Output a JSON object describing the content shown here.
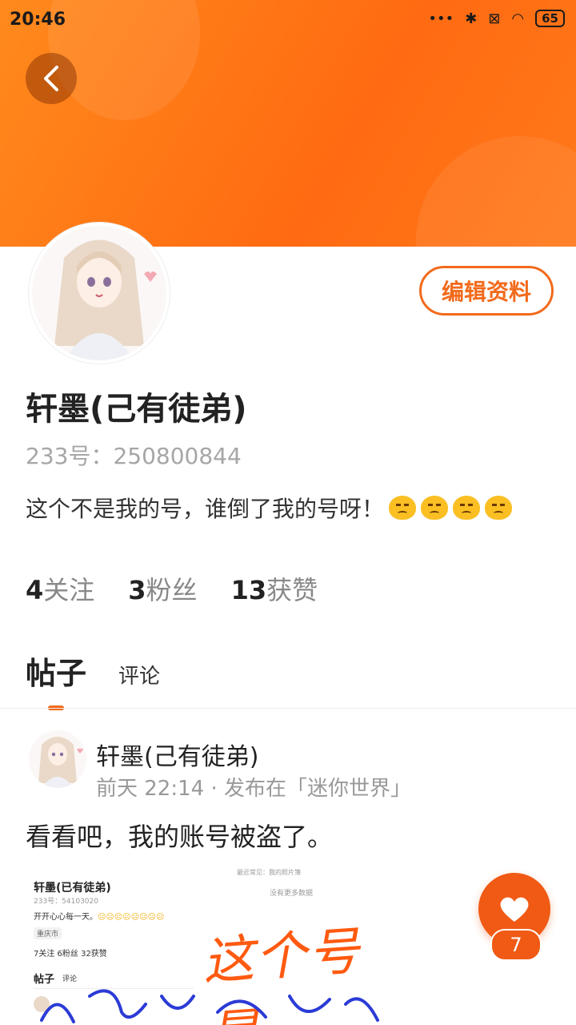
{
  "status_bar": {
    "time": "20:46",
    "battery": "65"
  },
  "profile": {
    "edit_label": "编辑资料",
    "name": "轩墨(己有徒弟)",
    "uid": "233号：250800844",
    "bio": "这个不是我的号，谁倒了我的号呀！",
    "bio_emojis": 4,
    "stats": [
      {
        "num": "4",
        "label": "关注"
      },
      {
        "num": "3",
        "label": "粉丝"
      },
      {
        "num": "13",
        "label": "获赞"
      }
    ]
  },
  "tabs": {
    "posts": "帖子",
    "comments": "评论"
  },
  "post": {
    "author": "轩墨(己有徒弟)",
    "meta": "前天 22:14 · 发布在「迷你世界」",
    "text": "看看吧，我的账号被盗了。",
    "like_count": "7",
    "image": {
      "name": "轩墨(已有徒弟)",
      "uid": "233号：54103020",
      "bio": "开开心心每一天。",
      "city": "重庆市",
      "stats": "7关注    6粉丝    32获赞",
      "tab_posts": "帖子",
      "tab_comments": "评论",
      "top_text": "最近常见：我的照片簿",
      "no_data": "没有更多数据",
      "handwriting": "这个号是"
    }
  },
  "colors": {
    "accent": "#f26a1b",
    "banner": "#ff7a1a"
  }
}
